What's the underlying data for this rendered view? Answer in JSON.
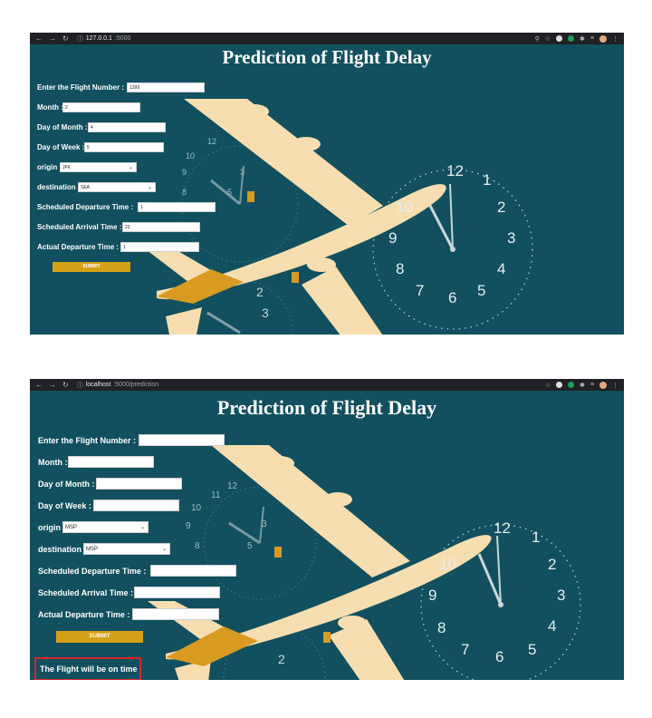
{
  "screens": [
    {
      "url_host": "127.0.0.1",
      "url_path": ":5000",
      "title": "Prediction of Flight Delay",
      "labels": {
        "flight_number": "Enter the Flight Number :",
        "month": "Month :",
        "day_of_month": "Day of Month :",
        "day_of_week": "Day of Week :",
        "origin": "origin",
        "destination": "destination",
        "sched_dep": "Scheduled Departure Time :",
        "sched_arr": "Scheduled Arrival Time :",
        "actual_dep": "Actual Departure Time :"
      },
      "values": {
        "flight_number": "1399",
        "month": "2",
        "day_of_month": "4",
        "day_of_week": "5",
        "origin": "JFK",
        "destination": "SEA",
        "sched_dep": "1",
        "sched_arr": "22",
        "actual_dep": "1"
      },
      "submit_label": "SUBMIT"
    },
    {
      "url_host": "localhost",
      "url_path": ":5000/prediction",
      "title": "Prediction of Flight Delay",
      "labels": {
        "flight_number": "Enter the Flight Number :",
        "month": "Month :",
        "day_of_month": "Day of Month :",
        "day_of_week": "Day of Week :",
        "origin": "origin",
        "destination": "destination",
        "sched_dep": "Scheduled Departure Time :",
        "sched_arr": "Scheduled Arrival Time :",
        "actual_dep": "Actual Departure Time :"
      },
      "values": {
        "origin": "MSP",
        "destination": "MSP"
      },
      "submit_label": "SUBMIT",
      "result": "The Flight will be on time"
    }
  ],
  "clock_numerals": [
    "12",
    "1",
    "2",
    "3",
    "4",
    "5",
    "6",
    "7",
    "8",
    "9",
    "10",
    "11"
  ],
  "colors": {
    "page_bg": "#12505f",
    "button": "#d4a017",
    "plane_body": "#f6deb0",
    "plane_accent": "#d89a20",
    "result_border": "#d8252b"
  }
}
